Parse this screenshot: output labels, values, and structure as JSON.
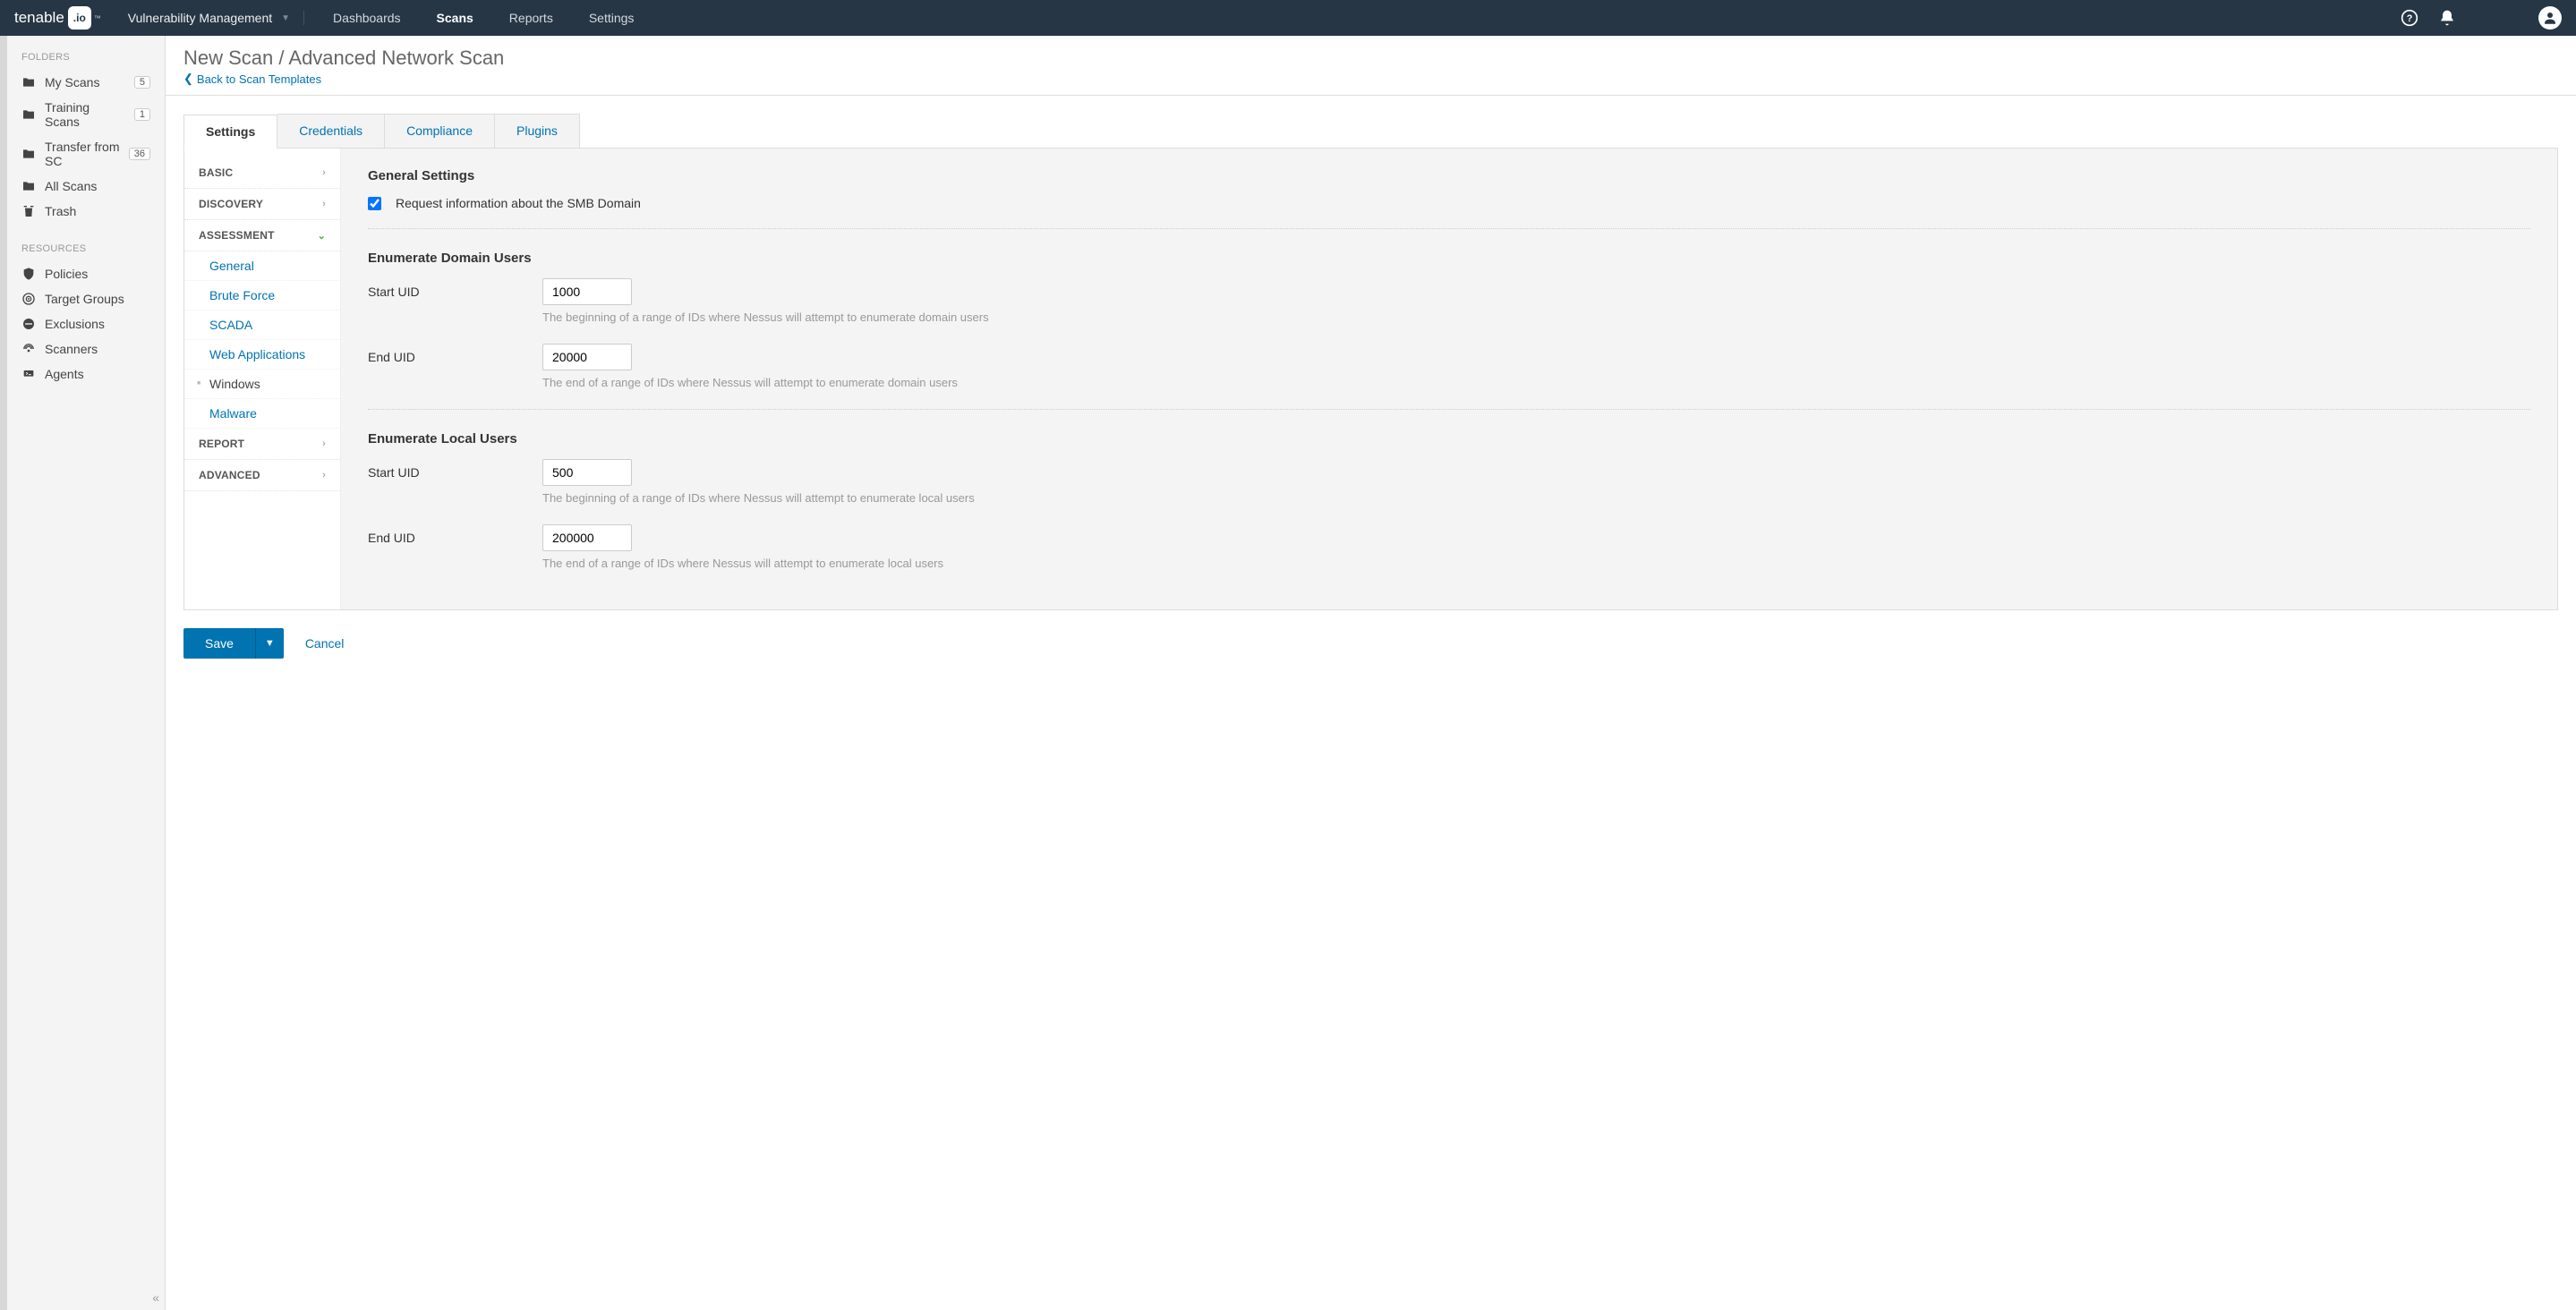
{
  "brand": {
    "name": "tenable",
    "tm": "™"
  },
  "app_switcher": "Vulnerability Management",
  "topnav": {
    "dashboards": "Dashboards",
    "scans": "Scans",
    "reports": "Reports",
    "settings": "Settings"
  },
  "sidebar": {
    "folders_title": "FOLDERS",
    "folders": [
      {
        "label": "My Scans",
        "count": "5"
      },
      {
        "label": "Training Scans",
        "count": "1"
      },
      {
        "label": "Transfer from SC",
        "count": "36"
      },
      {
        "label": "All Scans",
        "count": ""
      },
      {
        "label": "Trash",
        "count": ""
      }
    ],
    "resources_title": "RESOURCES",
    "resources": [
      {
        "label": "Policies"
      },
      {
        "label": "Target Groups"
      },
      {
        "label": "Exclusions"
      },
      {
        "label": "Scanners"
      },
      {
        "label": "Agents"
      }
    ]
  },
  "page": {
    "title": "New Scan / Advanced Network Scan",
    "back": "Back to Scan Templates"
  },
  "tabs": {
    "settings": "Settings",
    "credentials": "Credentials",
    "compliance": "Compliance",
    "plugins": "Plugins"
  },
  "settings_nav": {
    "basic": "BASIC",
    "discovery": "DISCOVERY",
    "assessment": "ASSESSMENT",
    "assessment_items": {
      "general": "General",
      "brute": "Brute Force",
      "scada": "SCADA",
      "web": "Web Applications",
      "windows": "Windows",
      "malware": "Malware"
    },
    "report": "REPORT",
    "advanced": "ADVANCED"
  },
  "form": {
    "general_title": "General Settings",
    "smb_label": "Request information about the SMB Domain",
    "enum_domain_title": "Enumerate Domain Users",
    "start_uid_label": "Start UID",
    "end_uid_label": "End UID",
    "domain_start_uid": "1000",
    "domain_start_help": "The beginning of a range of IDs where Nessus will attempt to enumerate domain users",
    "domain_end_uid": "20000",
    "domain_end_help": "The end of a range of IDs where Nessus will attempt to enumerate domain users",
    "enum_local_title": "Enumerate Local Users",
    "local_start_uid": "500",
    "local_start_help": "The beginning of a range of IDs where Nessus will attempt to enumerate local users",
    "local_end_uid": "200000",
    "local_end_help": "The end of a range of IDs where Nessus will attempt to enumerate local users"
  },
  "actions": {
    "save": "Save",
    "cancel": "Cancel"
  }
}
